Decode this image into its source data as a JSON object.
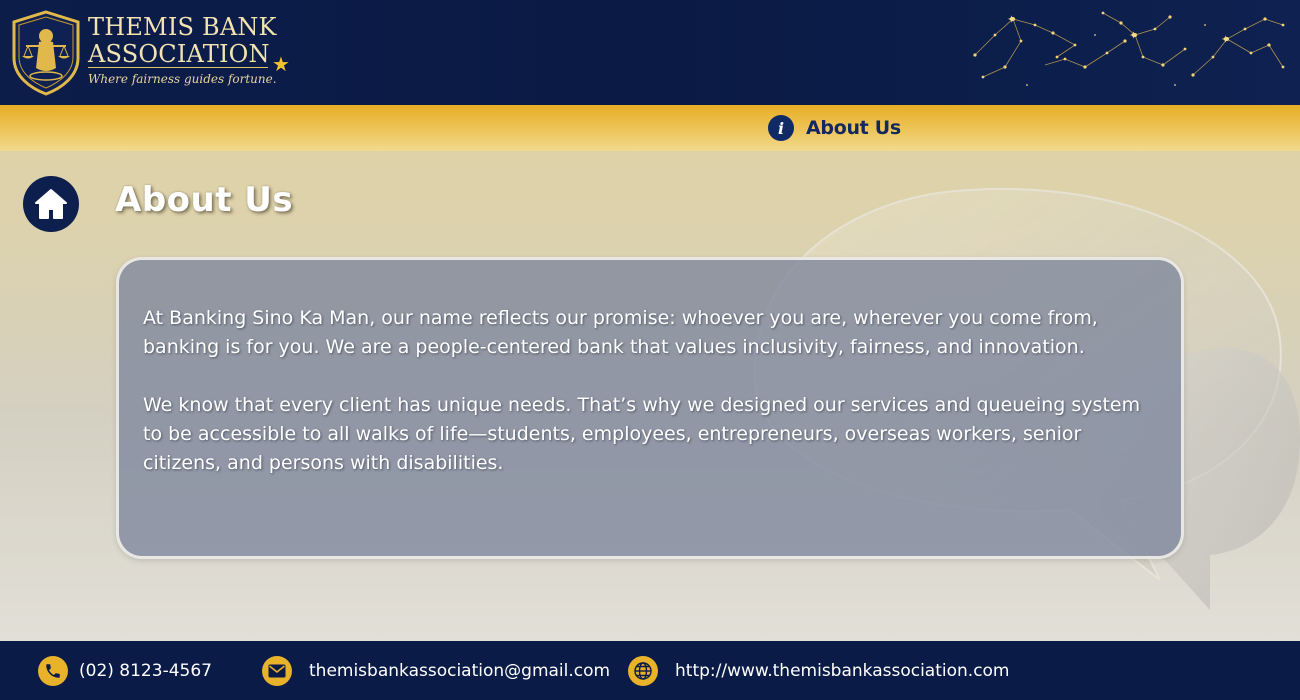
{
  "header": {
    "brand_line1": "THEMIS BANK",
    "brand_line2": "ASSOCIATION",
    "tagline": "Where fairness guides fortune.",
    "logo_icon": "lady-justice-shield-icon",
    "decoration_icon": "constellation-stars"
  },
  "nav": {
    "items": [
      {
        "label": "About Us",
        "icon": "info-icon",
        "active": true
      }
    ]
  },
  "page": {
    "title": "About Us",
    "home_icon": "home-icon"
  },
  "content": {
    "paragraphs": [
      "At Banking Sino Ka Man, our name reflects our promise: whoever you are, wherever you come from, banking is for you. We are a people-centered bank that values inclusivity, fairness, and innovation.",
      "We know that every client has unique needs. That’s why we designed our services and queueing system to be accessible to all walks of life—students, employees, entrepreneurs, overseas workers, senior citizens, and persons with disabilities."
    ]
  },
  "footer": {
    "phone": "(02) 8123-4567",
    "email": "themisbankassociation@gmail.com",
    "website": "http://www.themisbankassociation.com"
  },
  "colors": {
    "navy": "#0c1d4a",
    "gold": "#e7ae25",
    "card": "#80889e",
    "page_bg": "#e3d3a3"
  }
}
